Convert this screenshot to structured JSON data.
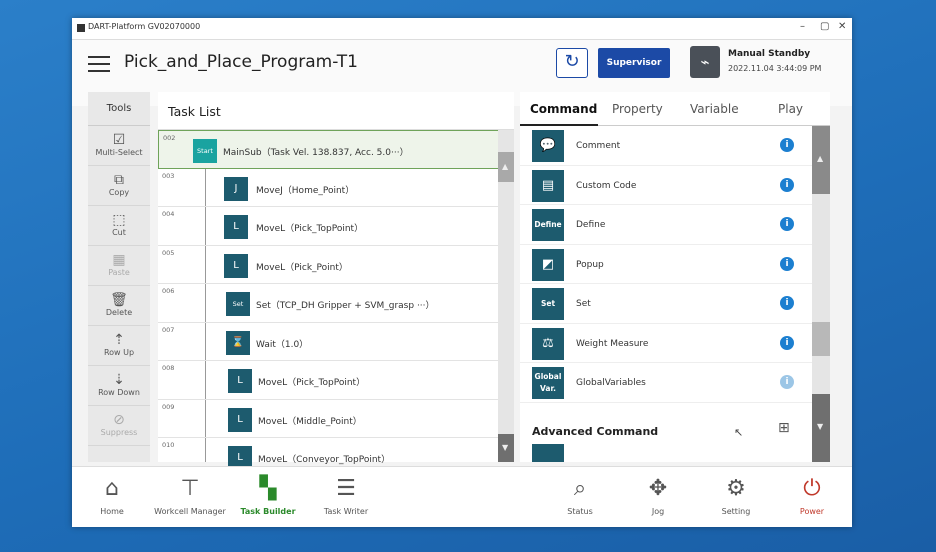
{
  "window": {
    "title": "DART-Platform GV02070000"
  },
  "header": {
    "program_title": "Pick_and_Place_Program-T1",
    "supervisor_label": "Supervisor",
    "status": "Manual Standby",
    "timestamp": "2022.11.04 3:44:09 PM"
  },
  "tools": {
    "title": "Tools",
    "items": [
      {
        "label": "Multi-Select",
        "icon": "multi-select-icon",
        "enabled": true
      },
      {
        "label": "Copy",
        "icon": "copy-icon",
        "enabled": true
      },
      {
        "label": "Cut",
        "icon": "cut-icon",
        "enabled": true
      },
      {
        "label": "Paste",
        "icon": "paste-icon",
        "enabled": false
      },
      {
        "label": "Delete",
        "icon": "trash-icon",
        "enabled": true
      },
      {
        "label": "Row Up",
        "icon": "row-up-icon",
        "enabled": true
      },
      {
        "label": "Row Down",
        "icon": "row-down-icon",
        "enabled": true
      },
      {
        "label": "Suppress",
        "icon": "suppress-icon",
        "enabled": false
      }
    ]
  },
  "tasklist": {
    "title": "Task List",
    "rows": [
      {
        "num": "002",
        "icon_text": "Start",
        "text": "MainSub（Task Vel. 138.837, Acc. 5.0···）"
      },
      {
        "num": "003",
        "icon_text": "J",
        "text": "MoveJ（Home_Point）"
      },
      {
        "num": "004",
        "icon_text": "L",
        "text": "MoveL（Pick_TopPoint）"
      },
      {
        "num": "005",
        "icon_text": "L",
        "text": "MoveL（Pick_Point）"
      },
      {
        "num": "006",
        "icon_text": "Set",
        "text": "Set（TCP_DH Gripper + SVM_grasp ···）"
      },
      {
        "num": "007",
        "icon_text": "⌛",
        "text": "Wait（1.0）"
      },
      {
        "num": "008",
        "icon_text": "L",
        "text": "MoveL（Pick_TopPoint）"
      },
      {
        "num": "009",
        "icon_text": "L",
        "text": "MoveL（Middle_Point）"
      },
      {
        "num": "010",
        "icon_text": "L",
        "text": "MoveL（Conveyor_TopPoint）"
      }
    ]
  },
  "right_panel": {
    "tabs": [
      "Command",
      "Property",
      "Variable",
      "Play"
    ],
    "commands": [
      {
        "label": "Comment",
        "icon_text": "💬"
      },
      {
        "label": "Custom Code",
        "icon_text": "▤"
      },
      {
        "label": "Define",
        "icon_text": "Define"
      },
      {
        "label": "Popup",
        "icon_text": "◩"
      },
      {
        "label": "Set",
        "icon_text": "Set"
      },
      {
        "label": "Weight Measure",
        "icon_text": "⚖"
      },
      {
        "label": "GlobalVariables",
        "icon_text": "Global Var."
      }
    ],
    "advanced_label": "Advanced Command"
  },
  "bottom_nav": {
    "left": [
      "Home",
      "Workcell Manager",
      "Task Builder",
      "Task Writer"
    ],
    "right": [
      "Status",
      "Jog",
      "Setting",
      "Power"
    ]
  },
  "colors": {
    "primary": "#1c4aa6",
    "icon_bg": "#1d5b6e",
    "active_green": "#2b8a2b",
    "power_red": "#c0392b"
  }
}
